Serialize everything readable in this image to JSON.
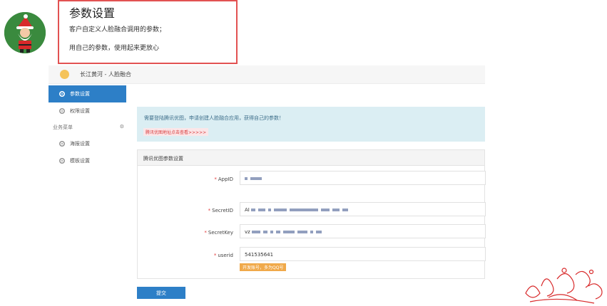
{
  "callout": {
    "title": "参数设置",
    "line1": "客户自定义人脸融合调用的参数；",
    "line2": "用自己的参数，使用起来更放心"
  },
  "header": {
    "brand": "长江黄河 - 人脸融合"
  },
  "sidebar": {
    "items": [
      {
        "label": "参数设置",
        "icon": "gear-icon",
        "active": true
      },
      {
        "label": "权限设置",
        "icon": "gear-icon",
        "active": false
      }
    ],
    "group_label": "业务菜单",
    "group_items": [
      {
        "label": "海报设置",
        "icon": "gear-icon"
      },
      {
        "label": "模板设置",
        "icon": "gear-icon"
      }
    ]
  },
  "notice": {
    "message": "需要登陆腾讯优图，申请创建人脸融合应用，获得自己的参数！",
    "link": "腾讯优图地址点击查看>>>>>"
  },
  "form": {
    "title": "腾讯优图参数设置",
    "fields": [
      {
        "label": "AppID",
        "value": ""
      },
      {
        "label": "SecretID",
        "value": "AI"
      },
      {
        "label": "SecretKey",
        "value": "vz"
      },
      {
        "label": "userid",
        "value": "541535641"
      }
    ],
    "hint": "开发账号，多为QQ号",
    "submit_label": "提交"
  },
  "colors": {
    "accent": "#2d7fc7",
    "callout_border": "#e25252",
    "notice_bg": "#dbeef3",
    "hint_bg": "#f0a94a"
  }
}
